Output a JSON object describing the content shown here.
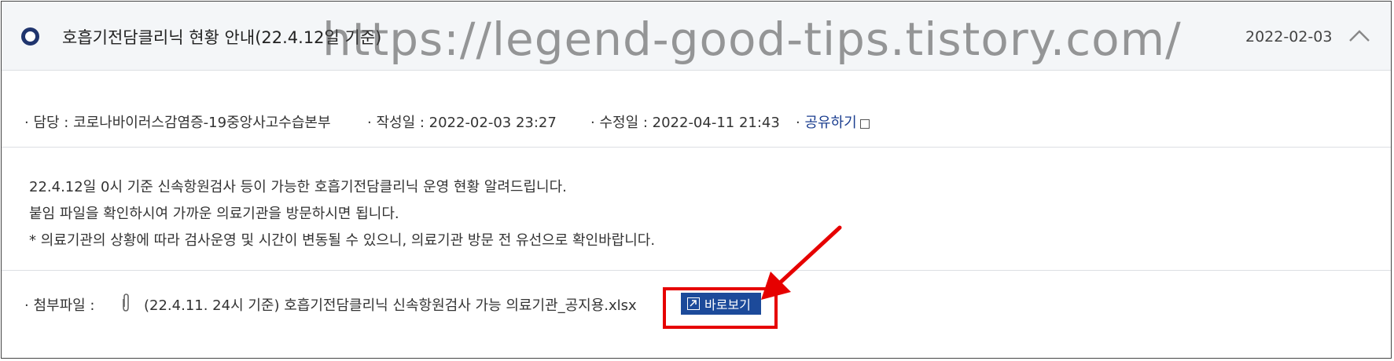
{
  "header": {
    "title": "호흡기전담클리닉 현황 안내(22.4.12일 기준)",
    "date": "2022-02-03"
  },
  "watermark": "https://legend-good-tips.tistory.com/",
  "meta": {
    "owner": "· 담당 : 코로나바이러스감염증-19중앙사고수습본부",
    "created": "· 작성일 : 2022-02-03 23:27",
    "modified": "· 수정일 : 2022-04-11 21:43",
    "share_bullet": "·",
    "share_label": "공유하기"
  },
  "body": {
    "lines": [
      "22.4.12일 0시 기준 신속항원검사 등이 가능한 호흡기전담클리닉 운영 현황 알려드립니다.",
      "붙임 파일을 확인하시여 가까운 의료기관을 방문하시면 됩니다.",
      "* 의료기관의 상황에 따라 검사운영 및 시간이 변동될 수 있으니, 의료기관 방문 전 유선으로 확인바랍니다."
    ]
  },
  "attachment": {
    "label": "· 첨부파일 :",
    "filename": "(22.4.11. 24시 기준) 호흡기전담클리닉 신속항원검사 가능 의료기관_공지용.xlsx",
    "view_button": "바로보기"
  },
  "colors": {
    "accent": "#1c4a9a",
    "highlight": "#e60000",
    "header_bg": "#f4f6f8"
  }
}
